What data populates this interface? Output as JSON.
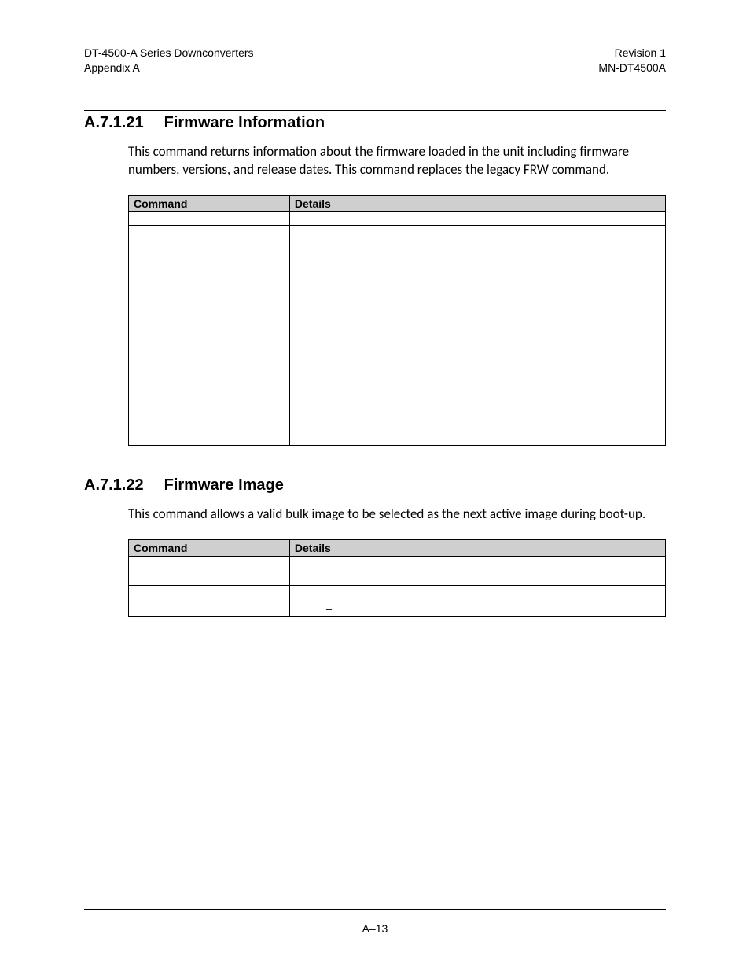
{
  "header": {
    "left1": "DT-4500-A Series Downconverters",
    "left2": "Appendix A",
    "right1": "Revision 1",
    "right2": "MN-DT4500A"
  },
  "section1": {
    "number": "A.7.1.21",
    "title": "Firmware Information",
    "paragraph": "This command returns information about the firmware loaded in the unit including firmware numbers, versions, and release dates. This command replaces the legacy FRW command.",
    "table": {
      "col1": "Command",
      "col2": "Details"
    }
  },
  "section2": {
    "number": "A.7.1.22",
    "title": "Firmware Image",
    "paragraph": "This command allows a valid bulk image to be selected as the next active image during boot-up.",
    "table": {
      "col1": "Command",
      "col2": "Details",
      "dash": "–"
    }
  },
  "footer": {
    "pagenum": "A–13"
  }
}
